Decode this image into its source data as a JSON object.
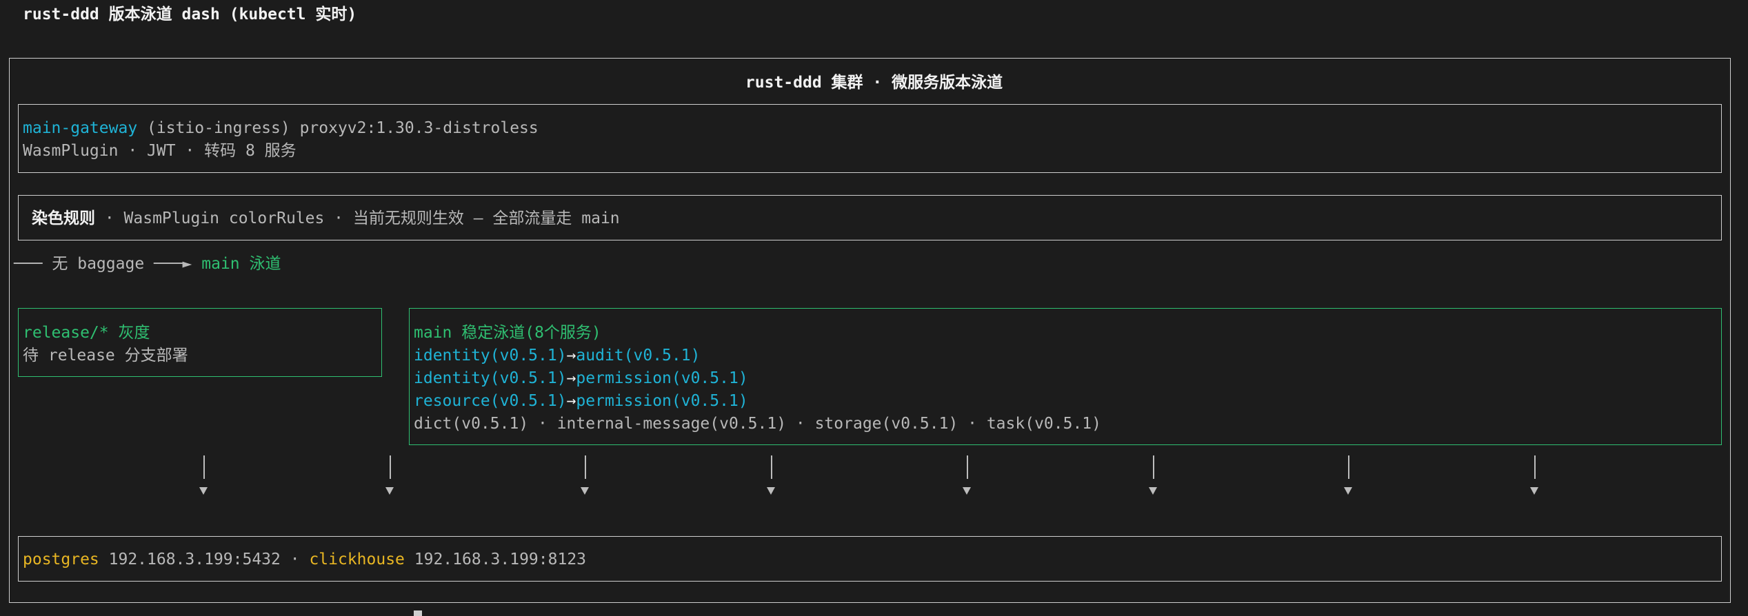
{
  "window_title": "rust-ddd 版本泳道 dash (kubectl 实时)",
  "cluster_title": "rust-ddd 集群 · 微服务版本泳道",
  "gateway": {
    "name": "main-gateway",
    "detail": " (istio-ingress) proxyv2:1.30.3-distroless",
    "line2": "WasmPlugin · JWT · 转码 8 服务"
  },
  "coloring": {
    "label": "染色规则",
    "text": " · WasmPlugin colorRules · 当前无规则生效 — 全部流量走 main"
  },
  "route": {
    "prefix": "─── 无 baggage ───►",
    "target": " main 泳道"
  },
  "release_lane": {
    "title": "release/* 灰度",
    "status": "待 release 分支部署"
  },
  "main_lane": {
    "title": "main 稳定泳道(8个服务)",
    "chains": [
      {
        "from": "identity(v0.5.1)",
        "arrow": "→",
        "to": "audit(v0.5.1)"
      },
      {
        "from": "identity(v0.5.1)",
        "arrow": "→",
        "to": "permission(v0.5.1)"
      },
      {
        "from": "resource(v0.5.1)",
        "arrow": "→",
        "to": "permission(v0.5.1)"
      }
    ],
    "others": "dict(v0.5.1) · internal-message(v0.5.1) · storage(v0.5.1) · task(v0.5.1)"
  },
  "datastores": {
    "pg_name": "postgres",
    "pg_addr": " 192.168.3.199:5432",
    "sep": " · ",
    "ch_name": "clickhouse",
    "ch_addr": " 192.168.3.199:8123"
  },
  "colors": {
    "background": "#1c1c1c",
    "cyan": "#1fb3d6",
    "green": "#2fbf71",
    "yellow": "#e8b623",
    "border": "#cfcfcf"
  }
}
